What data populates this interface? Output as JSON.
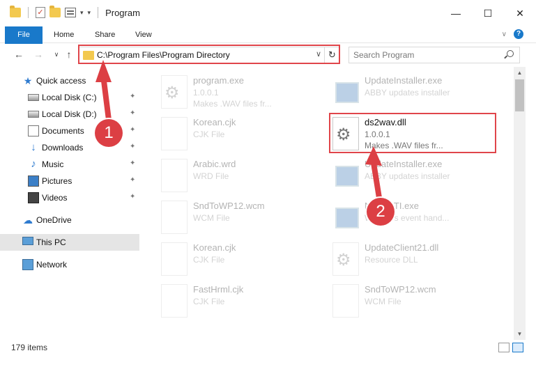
{
  "window": {
    "title": "Program"
  },
  "ribbon": {
    "file": "File",
    "home": "Home",
    "share": "Share",
    "view": "View",
    "help": "?"
  },
  "address": {
    "path": "C:\\Program Files\\Program Directory"
  },
  "search": {
    "placeholder": "Search Program"
  },
  "sidebar": {
    "quick_access": "Quick access",
    "items": [
      {
        "label": "Local Disk (C:)"
      },
      {
        "label": "Local Disk (D:)"
      },
      {
        "label": "Documents"
      },
      {
        "label": "Downloads"
      },
      {
        "label": "Music"
      },
      {
        "label": "Pictures"
      },
      {
        "label": "Videos"
      }
    ],
    "onedrive": "OneDrive",
    "this_pc": "This PC",
    "network": "Network"
  },
  "files": {
    "left": [
      {
        "name": "program.exe",
        "meta1": "1.0.0.1",
        "meta2": "Makes .WAV files fr..."
      },
      {
        "name": "Korean.cjk",
        "meta1": "CJK File",
        "meta2": ""
      },
      {
        "name": "Arabic.wrd",
        "meta1": "WRD File",
        "meta2": ""
      },
      {
        "name": "SndToWP12.wcm",
        "meta1": "WCM File",
        "meta2": ""
      },
      {
        "name": "Korean.cjk",
        "meta1": "CJK File",
        "meta2": ""
      },
      {
        "name": "FastHrml.cjk",
        "meta1": "CJK File",
        "meta2": ""
      }
    ],
    "right": [
      {
        "name": "UpdateInstaller.exe",
        "meta1": "ABBY updates installer",
        "meta2": ""
      },
      {
        "name": "ds2wav.dll",
        "meta1": "1.0.0.1",
        "meta2": "Makes .WAV files fr..."
      },
      {
        "name": "UpdateInstaller.exe",
        "meta1": "ABBY updates installer",
        "meta2": ""
      },
      {
        "name": "NotifySTI.exe",
        "meta1": "Windows event hand...",
        "meta2": ""
      },
      {
        "name": "UpdateClient21.dll",
        "meta1": "Resource DLL",
        "meta2": ""
      },
      {
        "name": "SndToWP12.wcm",
        "meta1": "WCM File",
        "meta2": ""
      }
    ]
  },
  "status": {
    "items_count": "179 items"
  },
  "annotations": {
    "step1": "1",
    "step2": "2",
    "color": "#dc3f44"
  }
}
